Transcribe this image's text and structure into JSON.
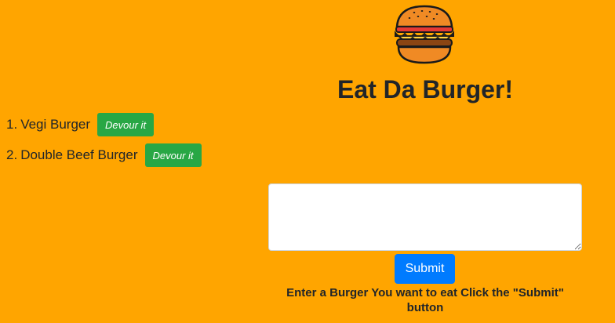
{
  "header": {
    "logo_icon": "hamburger-icon",
    "title": "Eat Da Burger!"
  },
  "burgers": [
    {
      "number": "1.",
      "name": "Vegi Burger",
      "button_label": "Devour it"
    },
    {
      "number": "2.",
      "name": "Double Beef Burger",
      "button_label": "Devour it"
    }
  ],
  "form": {
    "textarea_value": "",
    "textarea_placeholder": "",
    "submit_label": "Submit",
    "instructions": "Enter a Burger You want to eat Click the \"Submit\" button"
  },
  "colors": {
    "background": "#FFA500",
    "devour_button": "#28A745",
    "submit_button": "#007BFF",
    "text": "#212529"
  }
}
